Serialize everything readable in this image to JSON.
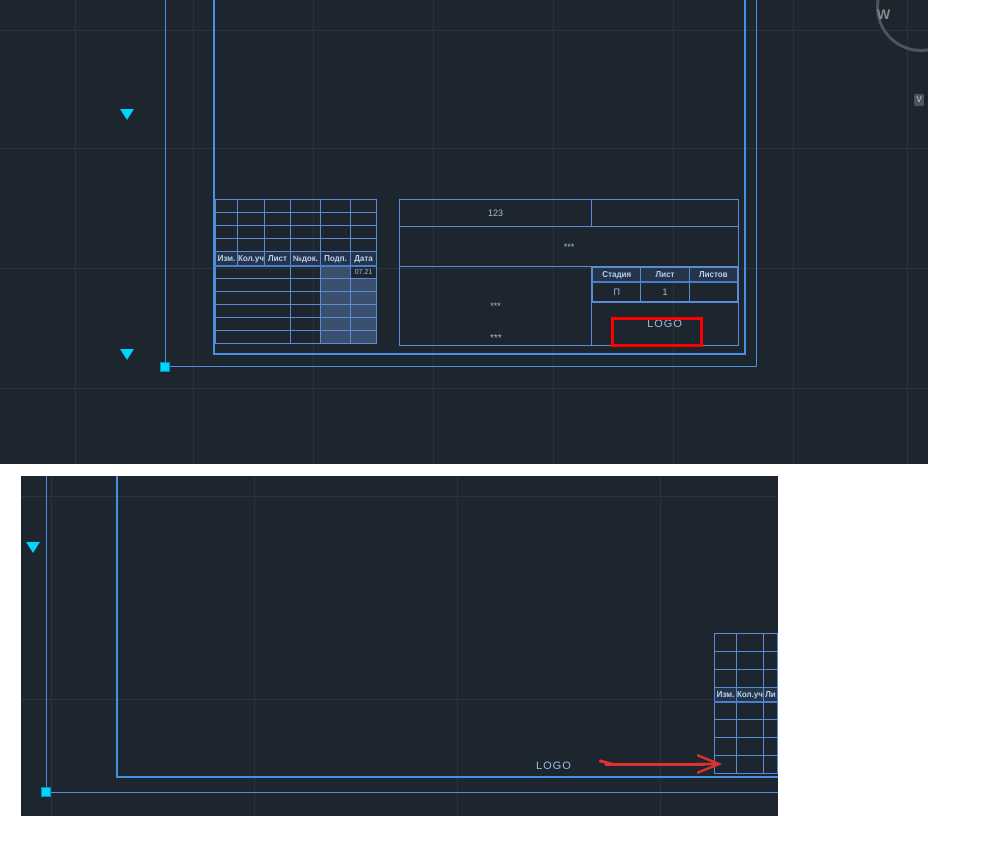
{
  "compass": {
    "direction": "W",
    "button": "V"
  },
  "titleblock": {
    "row1_value": "123",
    "row2_value": "***",
    "row3_value": "***",
    "row4_value": "***",
    "rev_headers": [
      "Изм.",
      "Кол.уч",
      "Лист",
      "№док.",
      "Подп.",
      "Дата"
    ],
    "date_value": "07.21",
    "right_headers": [
      "Стадия",
      "Лист",
      "Листов"
    ],
    "right_values": [
      "П",
      "1",
      ""
    ],
    "logo_text": "LOGO"
  },
  "panel2": {
    "rev_headers": [
      "Изм.",
      "Кол.уч",
      "Ли"
    ],
    "logo_text": "LOGO"
  }
}
